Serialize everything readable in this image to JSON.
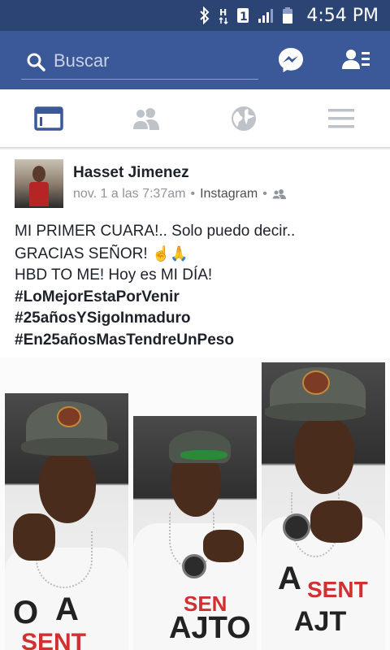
{
  "status_bar": {
    "time": "4:54 PM",
    "network_label": "H",
    "sim_label": "1",
    "icons": [
      "bluetooth-icon",
      "network-h-icon",
      "sim-1-icon",
      "signal-icon",
      "battery-icon"
    ]
  },
  "search": {
    "placeholder": "Buscar"
  },
  "header_icons": [
    "search-icon",
    "messenger-icon",
    "friend-requests-icon"
  ],
  "tabs": [
    {
      "name": "news-feed",
      "icon": "news-feed-icon",
      "active": true
    },
    {
      "name": "friends",
      "icon": "friends-icon",
      "active": false
    },
    {
      "name": "notifications",
      "icon": "globe-icon",
      "active": false
    },
    {
      "name": "menu",
      "icon": "hamburger-menu-icon",
      "active": false
    }
  ],
  "post": {
    "author": "Hasset Jimenez",
    "date": "nov. 1 a las 7:37am",
    "separator": "•",
    "source": "Instagram",
    "audience_icon": "friends-audience-icon",
    "lines": [
      "MI PRIMER CUARA!..  Solo puedo decir..",
      "GRACIAS SEÑOR!",
      "HBD TO ME! Hoy es MI DÍA!"
    ],
    "hashtags": [
      "#LoMejorEstaPorVenir",
      "#25añosYSigoInmaduro",
      "#En25añosMasTendreUnPeso"
    ],
    "photo": {
      "description_icon": "photo-collage",
      "shirt_text": [
        "O",
        "A",
        "SENTÓ",
        "AJTO"
      ]
    }
  },
  "colors": {
    "status_bar": "#2c4474",
    "header": "#3b5998",
    "tab_active": "#3b5998",
    "tab_inactive": "#bec2c9"
  }
}
